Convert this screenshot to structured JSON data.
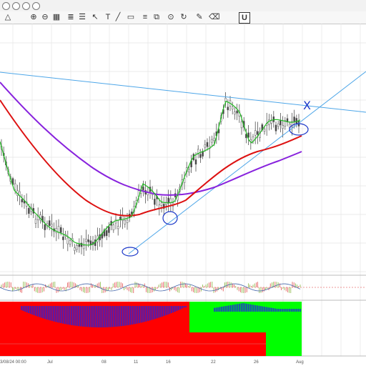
{
  "window": {
    "controls": [
      "min",
      "restore",
      "close",
      "link"
    ]
  },
  "toolbar": {
    "tools": [
      {
        "name": "triangle-tool",
        "glyph": "△"
      },
      {
        "name": "zoom-in-tool",
        "glyph": "⊕"
      },
      {
        "name": "zoom-out-tool",
        "glyph": "⊖"
      },
      {
        "name": "grid-tool",
        "glyph": "▦"
      },
      {
        "name": "bars-tool",
        "glyph": "≣"
      },
      {
        "name": "list-tool",
        "glyph": "☰"
      },
      {
        "name": "crosshair-tool",
        "glyph": "↖"
      },
      {
        "name": "text-tool",
        "glyph": "T"
      },
      {
        "name": "line-tool",
        "glyph": "╱"
      },
      {
        "name": "rect-tool",
        "glyph": "▭"
      },
      {
        "name": "fib-tool",
        "glyph": "≡"
      },
      {
        "name": "channel-tool",
        "glyph": "⧉"
      },
      {
        "name": "target-tool",
        "glyph": "⊙"
      },
      {
        "name": "cycle-tool",
        "glyph": "↻"
      },
      {
        "name": "pencil-tool",
        "glyph": "✎"
      },
      {
        "name": "eraser-tool",
        "glyph": "⌫"
      },
      {
        "name": "u-tool",
        "glyph": "U"
      }
    ]
  },
  "chart": {
    "date_labels": [
      "3/08/24 00:00",
      "Jul",
      "08",
      "11",
      "16",
      "22",
      "26",
      "Aug"
    ],
    "colors": {
      "ema_fast": "#22bb22",
      "ema_mid": "#dd1111",
      "ema_slow": "#8822dd",
      "trend": "#4da6e8",
      "annot": "#1a36c8",
      "candle": "#555555",
      "red_block": "#ff0000",
      "green_block": "#00ff00",
      "blue_hist": "#2222dd"
    },
    "annotation_mark": "X"
  }
}
